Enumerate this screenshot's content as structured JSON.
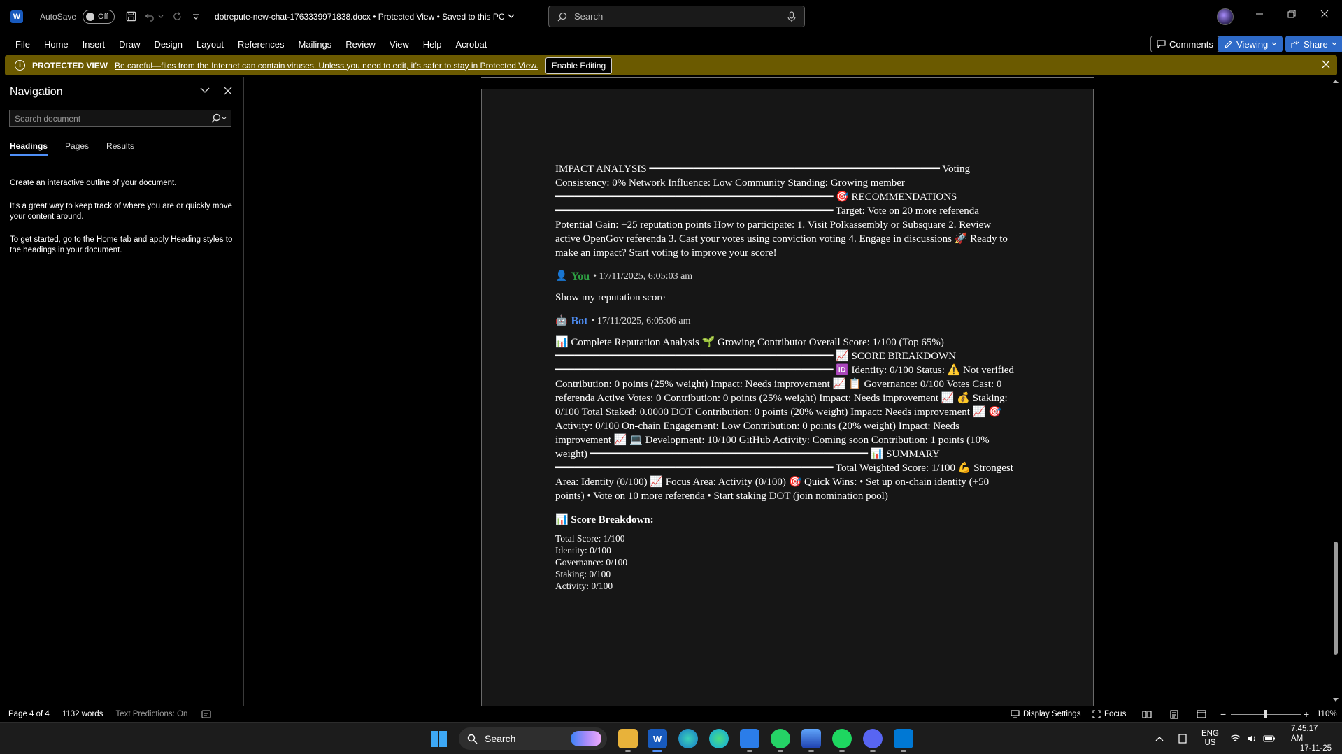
{
  "titlebar": {
    "autosave_label": "AutoSave",
    "autosave_state": "Off",
    "doc_title": "dotrepute-new-chat-1763339971838.docx  •  Protected View  •  Saved to this PC",
    "search_placeholder": "Search"
  },
  "menu": {
    "items": [
      "File",
      "Home",
      "Insert",
      "Draw",
      "Design",
      "Layout",
      "References",
      "Mailings",
      "Review",
      "View",
      "Help",
      "Acrobat"
    ],
    "comments": "Comments",
    "viewing": "Viewing",
    "share": "Share"
  },
  "protected_view": {
    "title": "PROTECTED VIEW",
    "message": "Be careful—files from the Internet can contain viruses. Unless you need to edit, it's safer to stay in Protected View.",
    "enable_button": "Enable Editing"
  },
  "navigation": {
    "title": "Navigation",
    "search_placeholder": "Search document",
    "tabs": [
      "Headings",
      "Pages",
      "Results"
    ],
    "help_1": "Create an interactive outline of your document.",
    "help_2": "It's a great way to keep track of where you are or quickly move your content around.",
    "help_3": "To get started, go to the Home tab and apply Heading styles to the headings in your document."
  },
  "document": {
    "para_impact": "IMPACT ANALYSIS ━━━━━━━━━━━━━━━━━━━━━━━━━━━━━━━━━━━━━━━━━━━━━━ Voting Consistency: 0% Network Influence: Low Community Standing: Growing member ━━━━━━━━━━━━━━━━━━━━━━━━━━━━━━━━━━━━━━━━━━━━ 🎯 RECOMMENDATIONS ━━━━━━━━━━━━━━━━━━━━━━━━━━━━━━━━━━━━━━━━━━━━ Target: Vote on 20 more referenda Potential Gain: +25 reputation points  How to participate: 1. Visit Polkassembly or Subsquare 2. Review active OpenGov referenda 3. Cast your votes using conviction voting 4. Engage in discussions  🚀 Ready to make an impact? Start voting to improve your score!",
    "you_icon": "👤",
    "you_name": "You",
    "you_time": "• 17/11/2025, 6:05:03 am",
    "you_msg": "Show my reputation score",
    "bot_icon": "🤖",
    "bot_name": "Bot",
    "bot_time": "• 17/11/2025, 6:05:06 am",
    "bot_msg": "📊 Complete Reputation Analysis  🌱 Growing Contributor Overall Score: 1/100 (Top 65%) ━━━━━━━━━━━━━━━━━━━━━━━━━━━━━━━━━━━━━━━━━━━━ 📈 SCORE BREAKDOWN ━━━━━━━━━━━━━━━━━━━━━━━━━━━━━━━━━━━━━━━━━━━━ 🆔 Identity: 0/100    Status: ⚠️ Not verified    Contribution: 0 points (25% weight)    Impact: Needs improvement 📈  📋 Governance: 0/100    Votes Cast: 0 referenda    Active Votes: 0    Contribution: 0 points (25% weight)    Impact: Needs improvement 📈  💰 Staking: 0/100    Total Staked: 0.0000 DOT    Contribution: 0 points (20% weight)    Impact: Needs improvement 📈  🎯 Activity: 0/100    On-chain Engagement: Low    Contribution: 0 points (20% weight)    Impact: Needs improvement 📈  💻 Development: 10/100    GitHub Activity: Coming soon    Contribution: 1 points (10% weight) ━━━━━━━━━━━━━━━━━━━━━━━━━━━━━━━━━━━━━━━━━━━━ 📊 SUMMARY ━━━━━━━━━━━━━━━━━━━━━━━━━━━━━━━━━━━━━━━━━━━━ Total Weighted Score: 1/100  💪 Strongest Area: Identity (0/100)  📈 Focus Area: Activity (0/100)  🎯 Quick Wins: • Set up on-chain identity (+50 points) • Vote on 10 more referenda • Start staking DOT (join nomination pool)",
    "score_heading": "📊 Score Breakdown:",
    "score_lines": [
      "Total Score: 1/100",
      "Identity: 0/100",
      "Governance: 0/100",
      "Staking: 0/100",
      "Activity: 0/100"
    ]
  },
  "statusbar": {
    "page": "Page 4 of 4",
    "words": "1132 words",
    "predictions": "Text Predictions: On",
    "display_settings": "Display Settings",
    "focus": "Focus",
    "zoom": "110%"
  },
  "taskbar": {
    "search": "Search",
    "lang_1": "ENG",
    "lang_2": "US",
    "time": "7.45.17 AM",
    "date": "17-11-25"
  },
  "colors": {
    "protected_bar": "#6b5a00",
    "accent": "#2e6ac8",
    "you": "#2ea043",
    "bot": "#4f8ff7"
  }
}
